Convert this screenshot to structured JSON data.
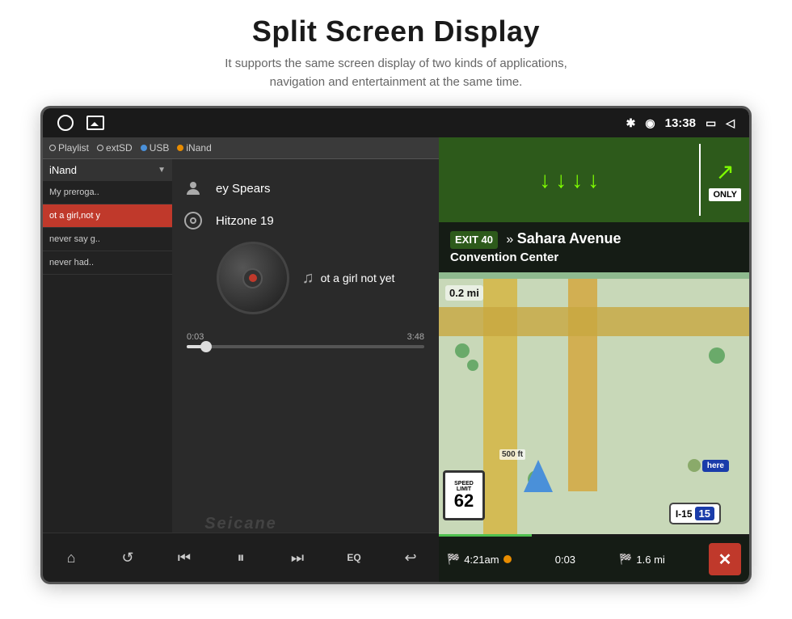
{
  "page": {
    "title": "Split Screen Display",
    "subtitle_line1": "It supports the same screen display of two kinds of applications,",
    "subtitle_line2": "navigation and entertainment at the same time."
  },
  "status_bar": {
    "time": "13:38",
    "bluetooth_icon": "bluetooth",
    "location_icon": "location-pin",
    "window_icon": "window",
    "back_icon": "back-arrow"
  },
  "music_player": {
    "source_tabs": [
      "Playlist",
      "extSD",
      "USB",
      "iNand"
    ],
    "active_source": "iNand",
    "playlist_header": "iNand",
    "playlist_items": [
      {
        "label": "My preroga..",
        "active": false
      },
      {
        "label": "ot a girl,not y",
        "active": true
      },
      {
        "label": "never say g..",
        "active": false
      },
      {
        "label": "never had..",
        "active": false
      }
    ],
    "now_playing": {
      "artist": "ey Spears",
      "album": "Hitzone 19",
      "track": "ot a girl not yet"
    },
    "progress": {
      "current": "0:03",
      "total": "3:48",
      "percent": 8
    },
    "controls": {
      "home": "⌂",
      "repeat": "↺",
      "prev": "⏮",
      "play_pause": "⏸",
      "next": "⏭",
      "eq": "EQ",
      "back": "↩"
    },
    "watermark": "Seicane"
  },
  "navigation": {
    "exit_number": "EXIT 40",
    "exit_street": "Sahara Avenue",
    "exit_place": "Convention Center",
    "speed_limit": {
      "label": "LIMIT",
      "value": "62"
    },
    "highway": "I-15",
    "highway_number": "15",
    "distance_turn": "0.2 mi",
    "bottom_bar": {
      "eta": "4:21am",
      "elapsed": "0:03",
      "remaining": "1.6 mi"
    },
    "only_label": "ONLY",
    "here_label": "here"
  }
}
